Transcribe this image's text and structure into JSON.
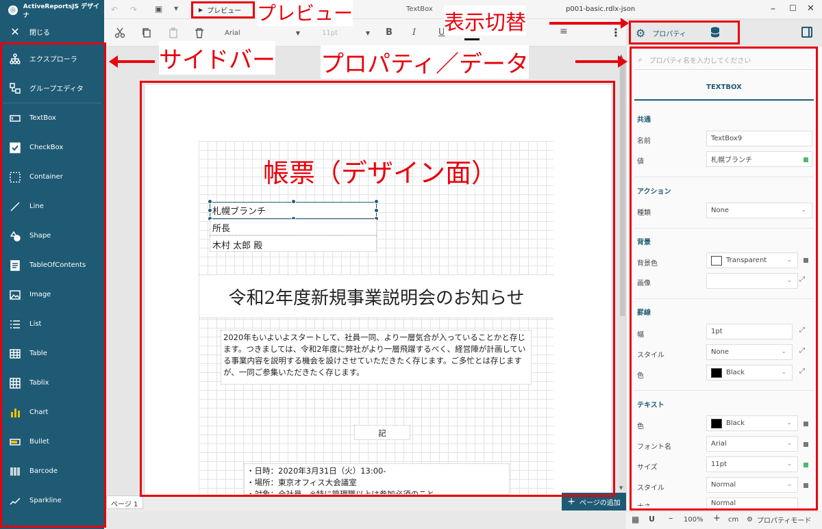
{
  "sidebar": {
    "brand": "ActiveReportsJS デザイナ",
    "close": "閉じる",
    "explorer": "エクスプローラ",
    "group_editor": "グループエディタ",
    "items": [
      "TextBox",
      "CheckBox",
      "Container",
      "Line",
      "Shape",
      "TableOfContents",
      "Image",
      "List",
      "Table",
      "Tablix",
      "Chart",
      "Bullet",
      "Barcode",
      "Sparkline"
    ]
  },
  "toolbar": {
    "preview": "プレビュー",
    "file_name": "p001-basic.rdlx-json",
    "tab_textbox": "TextBox",
    "font": "Arial",
    "size": "11pt",
    "properties_btn": "プロパティ"
  },
  "report": {
    "branch": "札幌ブランチ",
    "title_role": "所長",
    "person": "木村 太郎 殿",
    "heading": "令和2年度新規事業説明会のお知らせ",
    "body": "2020年もいよいよスタートして、社員一同、より一層気合が入っていることかと存じます。つきましては、令和2年度に弊社がより一層飛躍するべく、経営陣が計画している事業内容を説明する機会を設けさせていただきたく存じます。ご多忙とは存じますが、一同ご参集いただきたく存じます。",
    "ki": "記",
    "list1": "・日時：2020年3月31日（火）13:00-",
    "list2": "・場所：東京オフィス大会議室",
    "list3": "・対象：全社員　※特に管理職以上は参加必須のこと"
  },
  "pagebar": {
    "tab": "ページ 1",
    "add_page": "ページの追加"
  },
  "panel": {
    "search_placeholder": "プロパティ名を入力してください",
    "header": "TEXTBOX",
    "sections": {
      "common": "共通",
      "action": "アクション",
      "background": "背景",
      "border": "罫線",
      "text": "テキスト"
    },
    "fields": {
      "name_label": "名前",
      "name": "TextBox9",
      "value_label": "値",
      "value": "札幌ブランチ",
      "type_label": "種類",
      "type": "None",
      "bgcolor_label": "背景色",
      "bgcolor": "Transparent",
      "image_label": "画像",
      "image": "",
      "width_label": "幅",
      "width": "1pt",
      "style_label": "スタイル",
      "style": "None",
      "color_label": "色",
      "color": "Black",
      "tcolor_label": "色",
      "tcolor": "Black",
      "font_label": "フォント名",
      "font": "Arial",
      "size_label": "サイズ",
      "size": "11pt",
      "tstyle_label": "スタイル",
      "tstyle": "Normal",
      "weight_label": "太さ",
      "weight": "Normal"
    }
  },
  "status": {
    "zoom": "100%",
    "unit": "cm",
    "mode": "プロパティモード"
  },
  "annotations": {
    "preview": "プレビュー",
    "toggle": "表示切替",
    "sidebar": "サイドバー",
    "props": "プロパティ／データ",
    "report": "帳票（デザイン面）"
  },
  "colors": {
    "sidebar": "#1e5a74",
    "annotation": "#e8000b",
    "green_dot": "#4cbb6c",
    "gray_dot": "#777777"
  }
}
